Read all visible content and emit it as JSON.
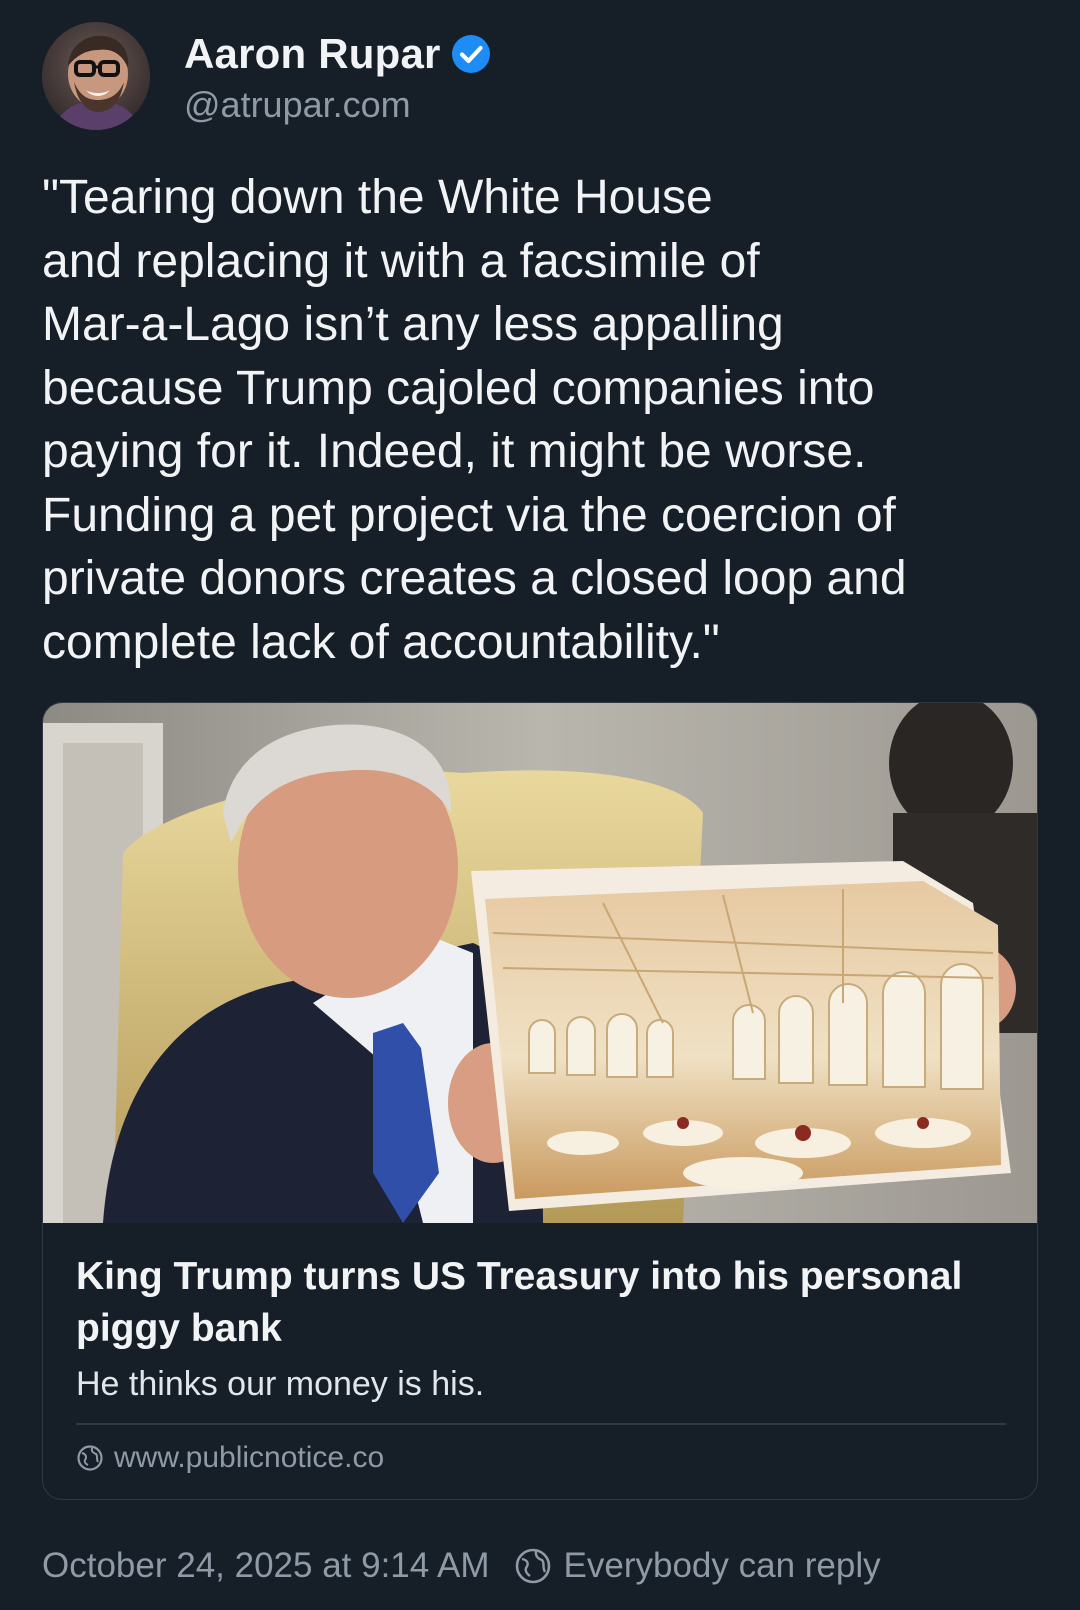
{
  "author": {
    "display_name": "Aaron Rupar",
    "handle": "@atrupar.com",
    "verified": true,
    "avatar_icon": "avatar-photo"
  },
  "post": {
    "text": "\"Tearing down the White House\nand replacing it with a facsimile of\nMar-a-Lago isn’t any less appalling\nbecause Trump cajoled companies into\npaying for it. Indeed, it might be worse.\nFunding a pet project via the coercion of\nprivate donors creates a closed loop and\ncomplete lack of accountability.\""
  },
  "link_card": {
    "title": "King Trump turns US Treasury into his personal piggy bank",
    "description": "He thinks our money is his.",
    "domain": "www.publicnotice.co",
    "image_icon": "article-photo"
  },
  "footer": {
    "timestamp": "October 24, 2025 at 9:14 AM",
    "reply_setting": "Everybody can reply"
  },
  "colors": {
    "background": "#161e27",
    "text_primary": "#f1f3f5",
    "text_secondary": "#8f9aa7",
    "verified_blue": "#1d8cf5",
    "border": "#2e3846"
  }
}
